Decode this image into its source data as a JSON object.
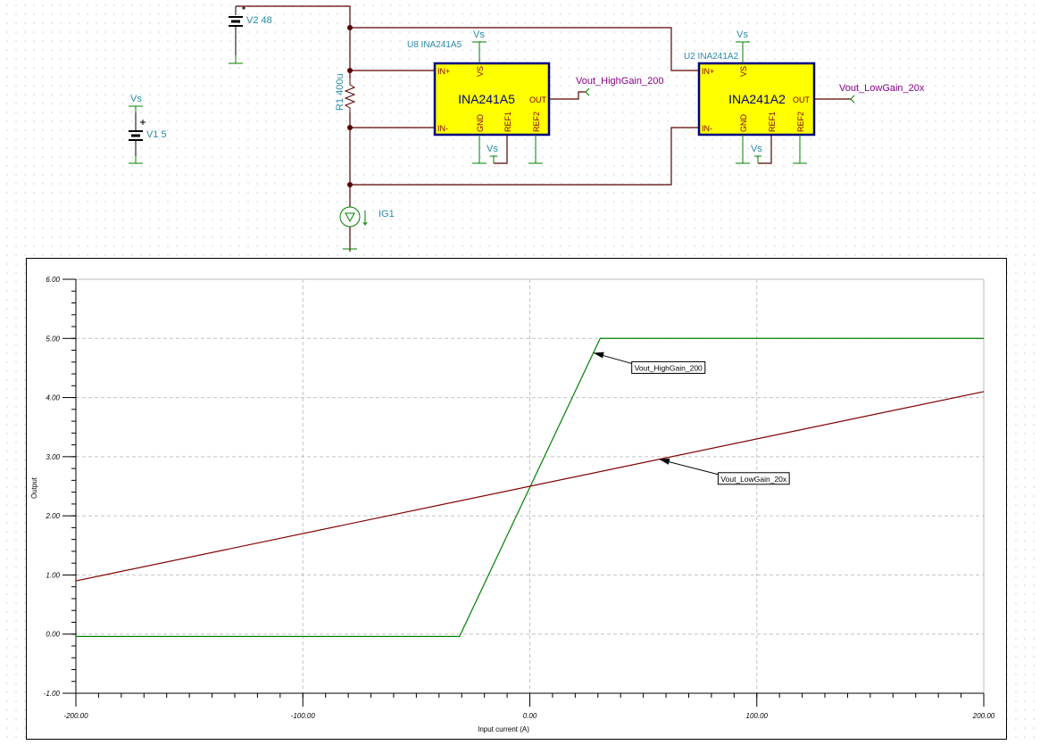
{
  "schematic": {
    "v2": {
      "label": "V2 48"
    },
    "v1": {
      "label": "V1 5",
      "supply": "Vs"
    },
    "r1": {
      "label": "R1 400u"
    },
    "ig1": {
      "label": "IG1"
    },
    "u8": {
      "ref": "U8 INA241A5",
      "name": "INA241A5",
      "supply": "Vs",
      "ref1_supply": "Vs",
      "pins": {
        "inp": "IN+",
        "inn": "IN-",
        "vs": "VS",
        "gnd": "GND",
        "ref1": "REF1",
        "ref2": "REF2",
        "out": "OUT"
      }
    },
    "u2": {
      "ref": "U2 INA241A2",
      "name": "INA241A2",
      "supply": "Vs",
      "ref1_supply": "Vs",
      "pins": {
        "inp": "IN+",
        "inn": "IN-",
        "vs": "VS",
        "gnd": "GND",
        "ref1": "REF1",
        "ref2": "REF2",
        "out": "OUT"
      }
    },
    "net_high": "Vout_HighGain_200",
    "net_low": "Vout_LowGain_20x",
    "colors": {
      "wire": "#5a0000",
      "pin": "#008000",
      "label": "#2a8aa8",
      "net": "#8a008a",
      "chip_fill": "#ffff00",
      "chip_border": "#000080"
    }
  },
  "chart_data": {
    "type": "line",
    "xlabel": "Input current (A)",
    "ylabel": "Output",
    "xlim": [
      -200,
      200
    ],
    "ylim": [
      -1,
      6
    ],
    "xticks": [
      -200,
      -100,
      0,
      100,
      200
    ],
    "xtick_labels": [
      "-200.00",
      "-100.00",
      "0.00",
      "100.00",
      "200.00"
    ],
    "yticks": [
      -1,
      0,
      1,
      2,
      3,
      4,
      5,
      6
    ],
    "ytick_labels": [
      "-1.00",
      "0.00",
      "1.00",
      "2.00",
      "3.00",
      "4.00",
      "5.00",
      "6.00"
    ],
    "grid": true,
    "series": [
      {
        "name": "Vout_HighGain_200",
        "color": "#008000",
        "x": [
          -200,
          -31,
          31,
          200
        ],
        "y": [
          -0.04,
          -0.04,
          5.0,
          5.0
        ],
        "annotation_x": 28
      },
      {
        "name": "Vout_LowGain_20x",
        "color": "#800000",
        "x": [
          -200,
          200
        ],
        "y": [
          0.9,
          4.1
        ],
        "annotation_x": 57
      }
    ]
  }
}
